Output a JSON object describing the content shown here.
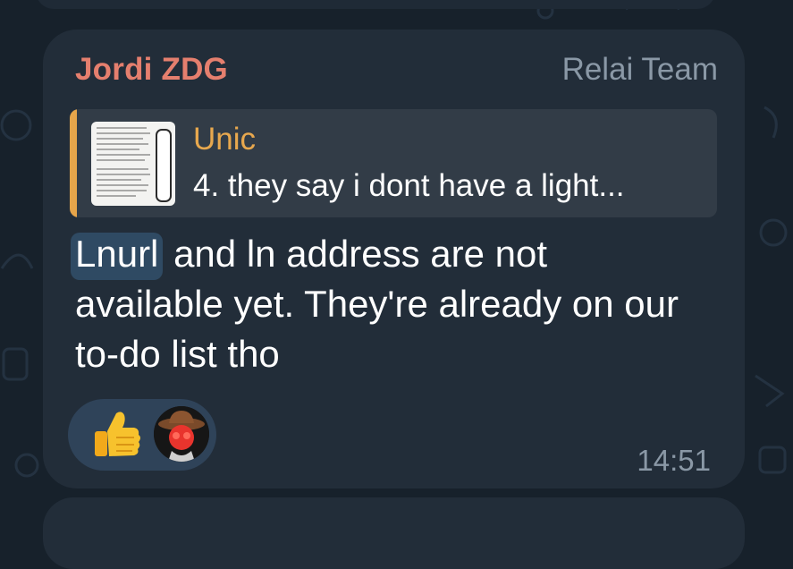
{
  "message": {
    "sender": "Jordi ZDG",
    "role": "Relai Team",
    "reply": {
      "author": "Unic",
      "text": "4. they say i dont have a light..."
    },
    "text_highlight": "Lnurl",
    "text_rest": " and ln address are not available yet. They're already on our to-do list tho",
    "time": "14:51"
  },
  "reactions": [
    {
      "type": "emoji",
      "icon": "thumbs-up-icon"
    },
    {
      "type": "avatar",
      "icon": "cowboy-avatar"
    }
  ],
  "colors": {
    "background": "#17212b",
    "bubble": "#222d39",
    "sender": "#e57f6e",
    "reply_accent": "#e6a54a",
    "reaction_bg": "#2f4359",
    "muted": "#8a98a6"
  }
}
